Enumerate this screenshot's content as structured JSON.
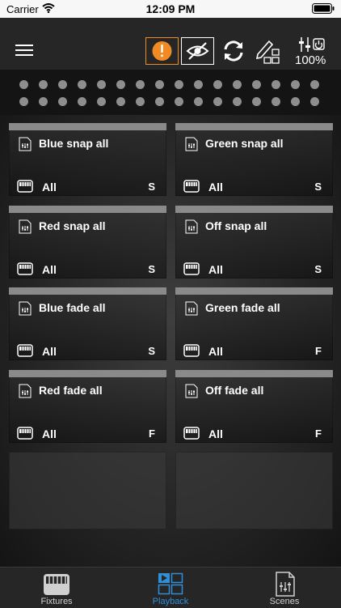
{
  "status_bar": {
    "carrier": "Carrier",
    "time": "12:09 PM"
  },
  "toolbar": {
    "zoom": "100%"
  },
  "dots": {
    "rows": 2,
    "per_row": 16
  },
  "cards": [
    {
      "title": "Blue snap all",
      "group": "All",
      "mode": "S"
    },
    {
      "title": "Green snap all",
      "group": "All",
      "mode": "S"
    },
    {
      "title": "Red snap all",
      "group": "All",
      "mode": "S"
    },
    {
      "title": "Off snap all",
      "group": "All",
      "mode": "S"
    },
    {
      "title": "Blue fade all",
      "group": "All",
      "mode": "S"
    },
    {
      "title": "Green fade all",
      "group": "All",
      "mode": "F"
    },
    {
      "title": "Red fade all",
      "group": "All",
      "mode": "F"
    },
    {
      "title": "Off fade all",
      "group": "All",
      "mode": "F"
    }
  ],
  "tabs": [
    {
      "label": "Fixtures",
      "active": false
    },
    {
      "label": "Playback",
      "active": true
    },
    {
      "label": "Scenes",
      "active": false
    }
  ],
  "colors": {
    "accent": "#2f8fd8",
    "warning": "#f08a24"
  }
}
